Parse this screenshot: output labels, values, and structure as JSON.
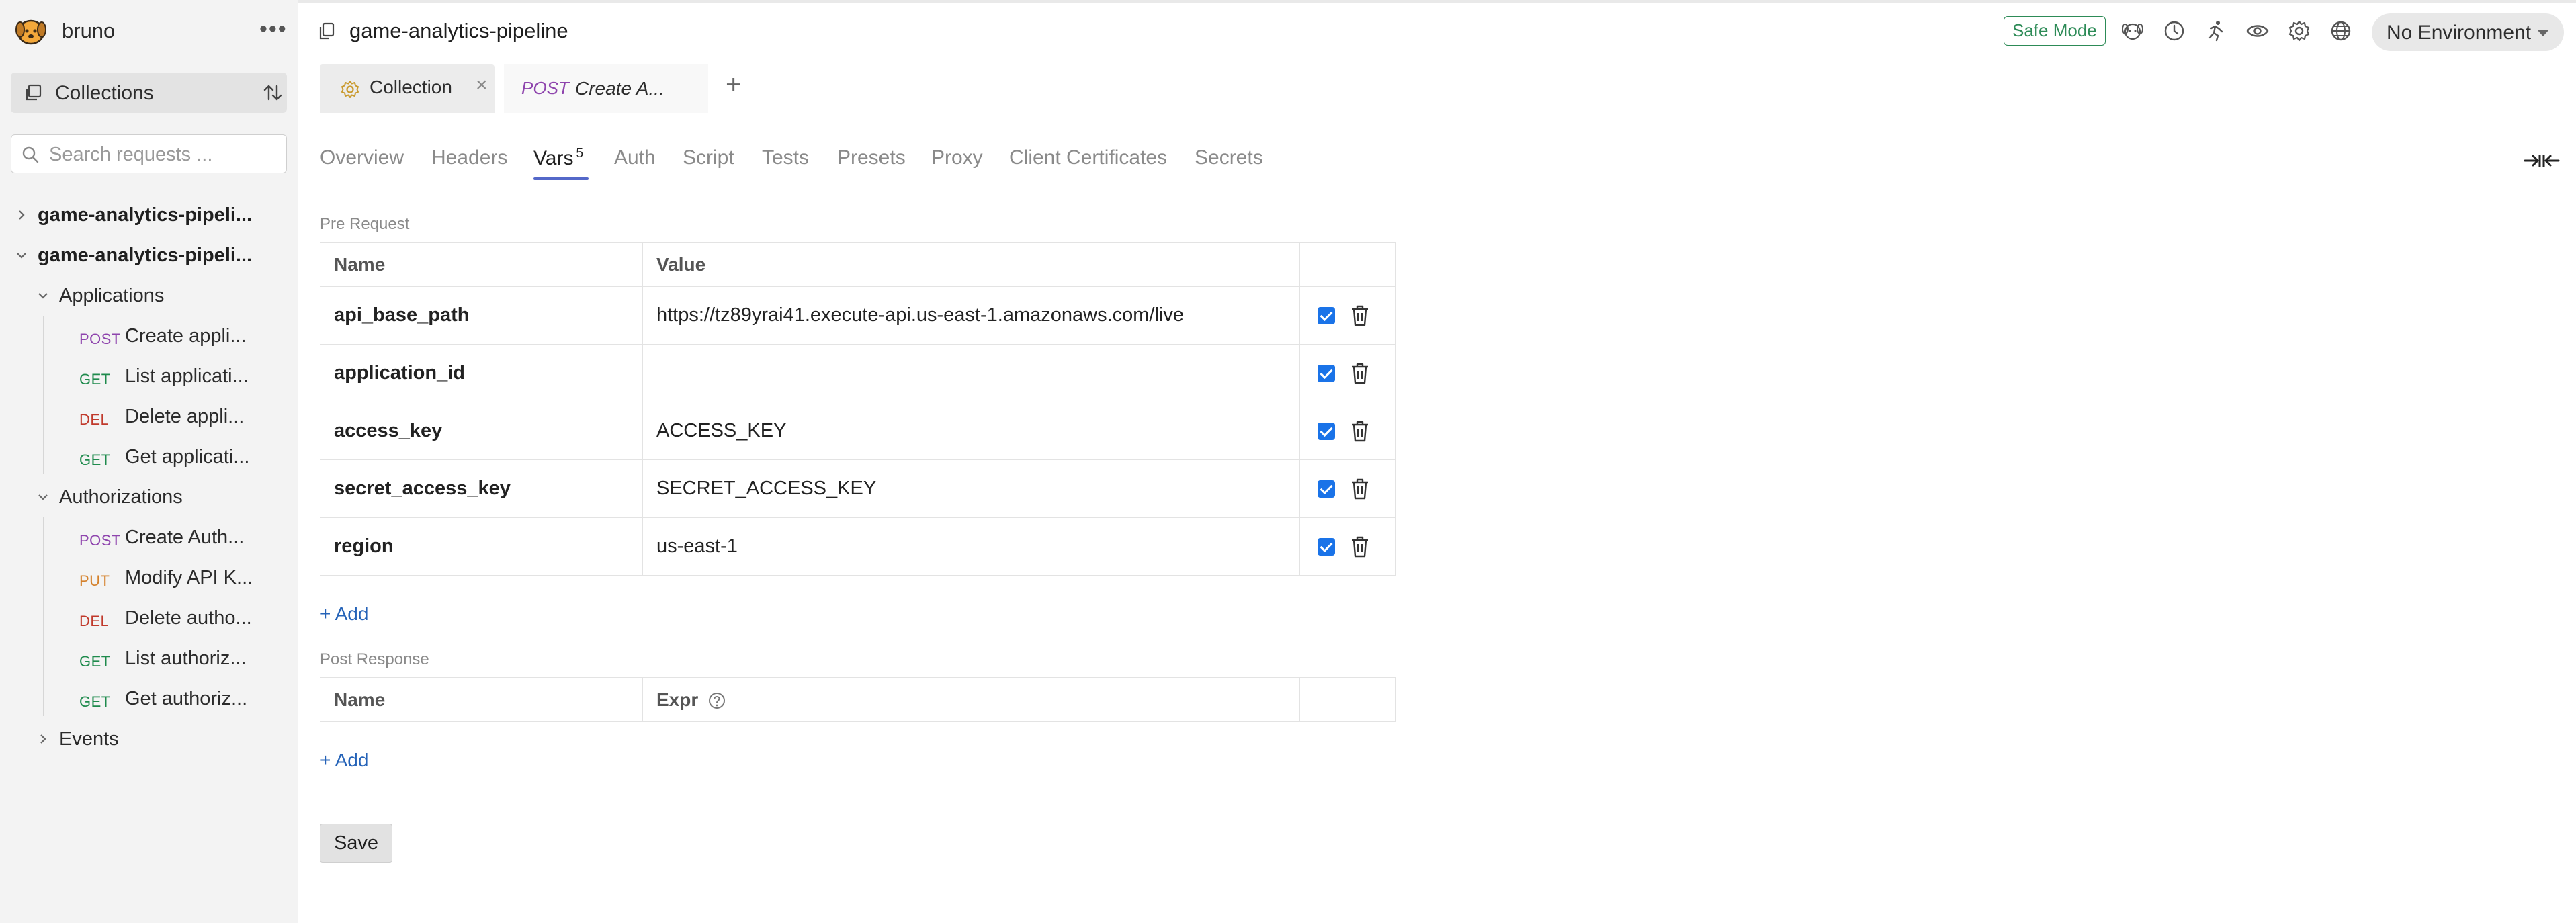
{
  "app": {
    "name": "bruno"
  },
  "sidebar": {
    "collections_label": "Collections",
    "search_placeholder": "Search requests ...",
    "tree": {
      "collection1": "game-analytics-pipeli...",
      "collection2": "game-analytics-pipeli...",
      "folders": {
        "applications": "Applications",
        "authorizations": "Authorizations",
        "events": "Events"
      },
      "applications": [
        {
          "method": "POST",
          "name": "Create appli..."
        },
        {
          "method": "GET",
          "name": "List applicati..."
        },
        {
          "method": "DEL",
          "name": "Delete appli..."
        },
        {
          "method": "GET",
          "name": "Get applicati..."
        }
      ],
      "authorizations": [
        {
          "method": "POST",
          "name": "Create Auth..."
        },
        {
          "method": "PUT",
          "name": "Modify API K..."
        },
        {
          "method": "DEL",
          "name": "Delete autho..."
        },
        {
          "method": "GET",
          "name": "List authoriz..."
        },
        {
          "method": "GET",
          "name": "Get authoriz..."
        }
      ]
    }
  },
  "header": {
    "title": "game-analytics-pipeline",
    "safe_mode": "Safe Mode",
    "environment": "No Environment"
  },
  "tabs": {
    "collection": "Collection",
    "request_method": "POST",
    "request_name": "Create A...",
    "close": "×",
    "add": "+"
  },
  "settings_tabs": {
    "overview": "Overview",
    "headers": "Headers",
    "vars": "Vars",
    "vars_count": "5",
    "auth": "Auth",
    "script": "Script",
    "tests": "Tests",
    "presets": "Presets",
    "proxy": "Proxy",
    "client_certificates": "Client Certificates",
    "secrets": "Secrets"
  },
  "pre_request": {
    "label": "Pre Request",
    "col_name": "Name",
    "col_value": "Value",
    "rows": [
      {
        "name": "api_base_path",
        "value": "https://tz89yrai41.execute-api.us-east-1.amazonaws.com/live",
        "enabled": true
      },
      {
        "name": "application_id",
        "value": "",
        "enabled": true
      },
      {
        "name": "access_key",
        "value": "ACCESS_KEY",
        "enabled": true
      },
      {
        "name": "secret_access_key",
        "value": "SECRET_ACCESS_KEY",
        "enabled": true
      },
      {
        "name": "region",
        "value": "us-east-1",
        "enabled": true
      }
    ],
    "add_label": "+ Add"
  },
  "post_response": {
    "label": "Post Response",
    "col_name": "Name",
    "col_expr": "Expr",
    "add_label": "+ Add"
  },
  "save_label": "Save",
  "colors": {
    "accent_tab": "#5468c9",
    "safe_mode": "#2d8b57",
    "checkbox": "#1a73e8",
    "link": "#2563b8",
    "method_post": "#8e44ad",
    "method_get": "#1e8a4c",
    "method_del": "#c0392b",
    "method_put": "#d4802a"
  }
}
